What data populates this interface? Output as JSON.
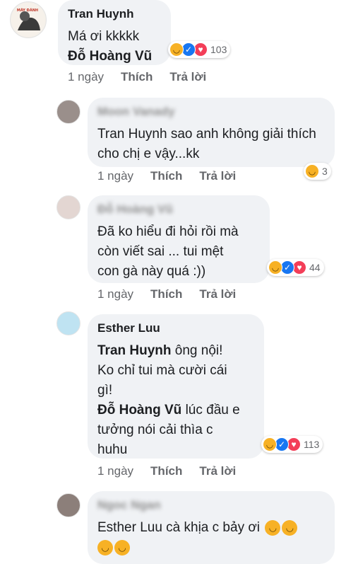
{
  "comments": [
    {
      "author": "Tran Huynh",
      "avatar_text": "MÁY ĐÁNH TAO ĐÊ!!",
      "lines": [
        "Má ơi kkkkk"
      ],
      "mention": "Đỗ Hoàng Vũ",
      "reaction_count": "103",
      "time": "1 ngày",
      "like": "Thích",
      "reply": "Trả lời"
    },
    {
      "author": "Moon Vanady",
      "mention": "Tran Huynh",
      "text": "sao anh không giải thích cho chị e vậy...kk",
      "reaction_count": "3",
      "time": "1 ngày",
      "like": "Thích",
      "reply": "Trả lời"
    },
    {
      "author": "Đỗ Hoàng Vũ",
      "line1": "Đã ko hiểu đi hỏi rồi mà",
      "line2": "còn viết sai ... tui mệt",
      "line3": "con gà này quá :))",
      "reaction_count": "44",
      "time": "1 ngày",
      "like": "Thích",
      "reply": "Trả lời"
    },
    {
      "author": "Esther Luu",
      "mention1": "Tran Huynh",
      "line1_rest": "ông nội!",
      "line2": "Ko chỉ tui mà cười cái",
      "line3": "gì!",
      "mention2": "Đỗ Hoàng Vũ",
      "line4_rest": "lúc đầu e",
      "line5": "tưởng nói cải thìa c",
      "line6": "huhu",
      "reaction_count": "113",
      "time": "1 ngày",
      "like": "Thích",
      "reply": "Trả lời"
    },
    {
      "author": "Ngoc Ngan",
      "line1": "Esther Luu cà khịa c bảy ơi"
    }
  ],
  "icons": {
    "haha": "😆",
    "like": "👍",
    "love": "♥",
    "crying_laugh": "😂"
  }
}
